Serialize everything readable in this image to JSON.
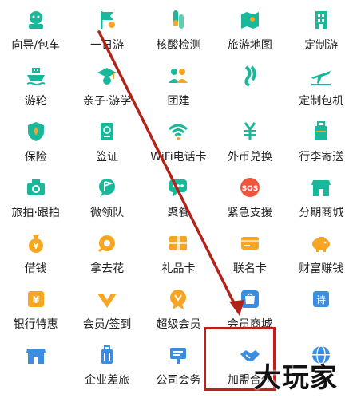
{
  "colors": {
    "accent": "#19b89a",
    "arrow": "#b1221b",
    "highlight_box": "#c0201a"
  },
  "grid": [
    {
      "icon": "guide-car-icon",
      "label": "向导/包车"
    },
    {
      "icon": "flag-icon",
      "label": "一日游"
    },
    {
      "icon": "test-tube-icon",
      "label": "核酸检测"
    },
    {
      "icon": "map-icon",
      "label": "旅游地图"
    },
    {
      "icon": "building-icon",
      "label": "定制游"
    },
    {
      "icon": "ship-icon",
      "label": "游轮"
    },
    {
      "icon": "parent-child-icon",
      "label": "亲子·游学"
    },
    {
      "icon": "team-icon",
      "label": "团建"
    },
    {
      "icon": "leaf-icon",
      "label": ""
    },
    {
      "icon": "plane-icon",
      "label": "定制包机"
    },
    {
      "icon": "shield-icon",
      "label": "保险"
    },
    {
      "icon": "passport-icon",
      "label": "签证"
    },
    {
      "icon": "wifi-icon",
      "label": "WiFi电话卡"
    },
    {
      "icon": "currency-icon",
      "label": "外币兑换"
    },
    {
      "icon": "luggage-icon",
      "label": "行李寄送"
    },
    {
      "icon": "camera-icon",
      "label": "旅拍·跟拍"
    },
    {
      "icon": "chat-flag-icon",
      "label": "微领队"
    },
    {
      "icon": "chat-icon",
      "label": "聚餐"
    },
    {
      "icon": "sos-icon",
      "label": "紧急支援"
    },
    {
      "icon": "shop-icon",
      "label": "分期商城"
    },
    {
      "icon": "money-bag-icon",
      "label": "借钱"
    },
    {
      "icon": "flower-icon",
      "label": "拿去花"
    },
    {
      "icon": "gift-card-icon",
      "label": "礼品卡"
    },
    {
      "icon": "card-icon",
      "label": "联名卡"
    },
    {
      "icon": "piggy-bank-icon",
      "label": "财富赚钱"
    },
    {
      "icon": "bank-card-icon",
      "label": "银行特惠"
    },
    {
      "icon": "vip-icon",
      "label": "会员/签到"
    },
    {
      "icon": "super-vip-icon",
      "label": "超级会员"
    },
    {
      "icon": "mall-icon",
      "label": "会员商城"
    },
    {
      "icon": "poem-icon",
      "label": ""
    },
    {
      "icon": "store-icon",
      "label": ""
    },
    {
      "icon": "suitcase-icon",
      "label": "企业差旅"
    },
    {
      "icon": "business-icon",
      "label": "公司会务"
    },
    {
      "icon": "handshake-icon",
      "label": "加盟合作"
    },
    {
      "icon": "globe-icon",
      "label": ""
    }
  ],
  "watermark": "大玩家"
}
